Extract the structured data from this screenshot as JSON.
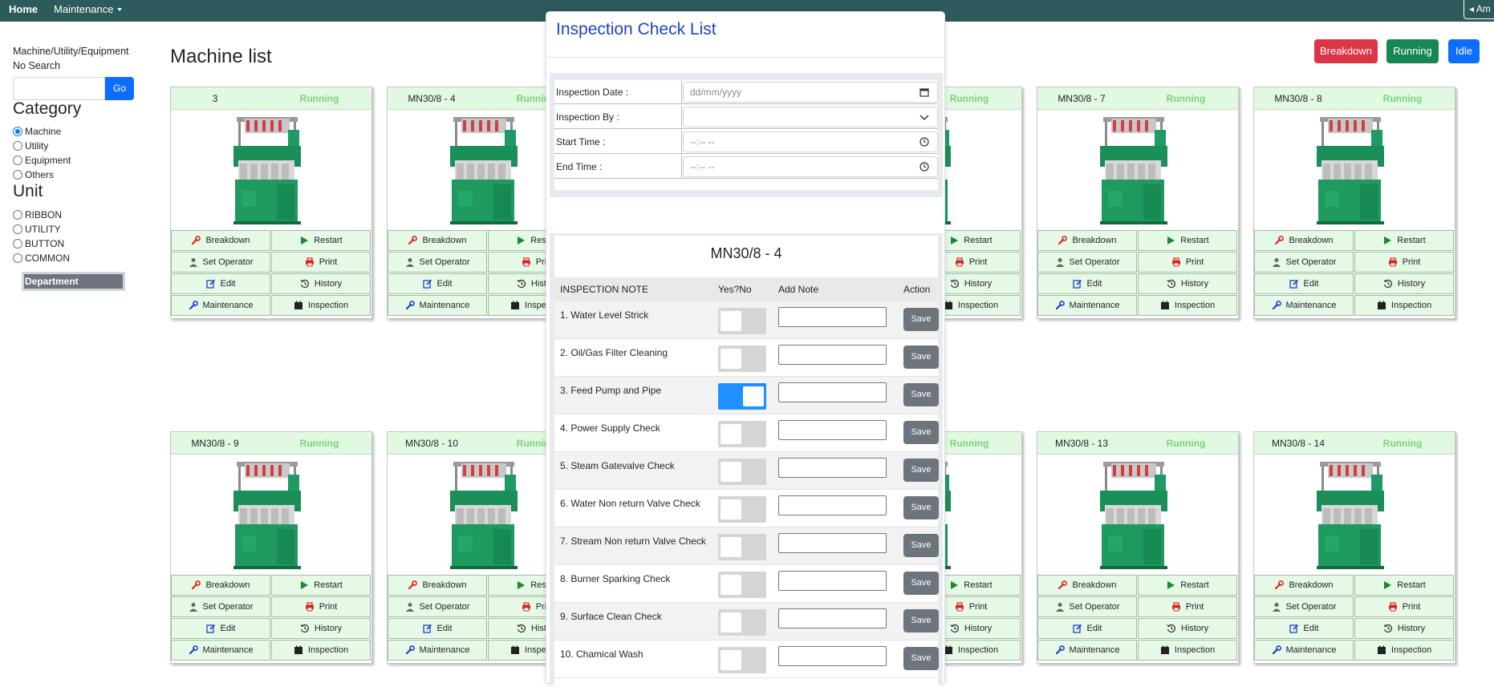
{
  "nav": {
    "home": "Home",
    "maintenance": "Maintenance",
    "user": "Am"
  },
  "sidebar": {
    "filter_label": "Machine/Utility/Equipment",
    "search_status": "No Search",
    "go_label": "Go",
    "category_heading": "Category",
    "categories": [
      {
        "label": "Machine",
        "checked": true
      },
      {
        "label": "Utility",
        "checked": false
      },
      {
        "label": "Equipment",
        "checked": false
      },
      {
        "label": "Others",
        "checked": false
      }
    ],
    "unit_heading": "Unit",
    "units": [
      {
        "label": "RIBBON"
      },
      {
        "label": "UTILITY"
      },
      {
        "label": "BUTTON"
      },
      {
        "label": "COMMON"
      }
    ],
    "department_label": "Department"
  },
  "main": {
    "title": "Machine list",
    "status_buttons": {
      "breakdown": "Breakdown",
      "running": "Running",
      "idle": "Idle"
    },
    "status_colors": {
      "breakdown": "#dc3545",
      "running": "#198754",
      "idle": "#0d6efd"
    }
  },
  "card_actions": [
    "Breakdown",
    "Restart",
    "Set Operator",
    "Print",
    "Edit",
    "History",
    "Maintenance",
    "Inspection"
  ],
  "machines": [
    {
      "name": "3",
      "status": "Running"
    },
    {
      "name": "MN30/8 - 4",
      "status": "Running"
    },
    {
      "name": "",
      "status": ""
    },
    {
      "name": "",
      "status": "Running"
    },
    {
      "name": "MN30/8 - 7",
      "status": "Running"
    },
    {
      "name": "MN30/8 - 8",
      "status": "Running"
    },
    {
      "name": "MN30/8 - 9",
      "status": "Running"
    },
    {
      "name": "MN30/8 - 10",
      "status": "Running"
    },
    {
      "name": "",
      "status": ""
    },
    {
      "name": "",
      "status": "Running"
    },
    {
      "name": "MN30/8 - 13",
      "status": "Running"
    },
    {
      "name": "MN30/8 - 14",
      "status": "Running"
    }
  ],
  "modal": {
    "title": "Inspection Check List",
    "form": {
      "inspection_date_label": "Inspection Date :",
      "inspection_date_value": "dd/mm/yyyy",
      "inspection_by_label": "Inspection By :",
      "inspection_by_value": "",
      "start_time_label": "Start Time :",
      "start_time_value": "--:-- --",
      "end_time_label": "End Time :",
      "end_time_value": "--:-- --"
    },
    "machine_name": "MN30/8 - 4",
    "headers": {
      "note": "INSPECTION NOTE",
      "yesno": "Yes?No",
      "add_note": "Add Note",
      "action": "Action"
    },
    "save_label": "Save",
    "items": [
      {
        "label": "1. Water Level Strick",
        "checked": false
      },
      {
        "label": "2. Oil/Gas Filter Cleaning",
        "checked": false
      },
      {
        "label": "3. Feed Pump and Pipe",
        "checked": true
      },
      {
        "label": "4. Power Supply Check",
        "checked": false
      },
      {
        "label": "5. Steam Gatevalve Check",
        "checked": false
      },
      {
        "label": "6. Water Non return Valve Check",
        "checked": false
      },
      {
        "label": "7. Stream Non return Valve Check",
        "checked": false
      },
      {
        "label": "8. Burner Sparking Check",
        "checked": false
      },
      {
        "label": "9. Surface Clean Check",
        "checked": false
      },
      {
        "label": "10. Chamical Wash",
        "checked": false
      }
    ]
  }
}
